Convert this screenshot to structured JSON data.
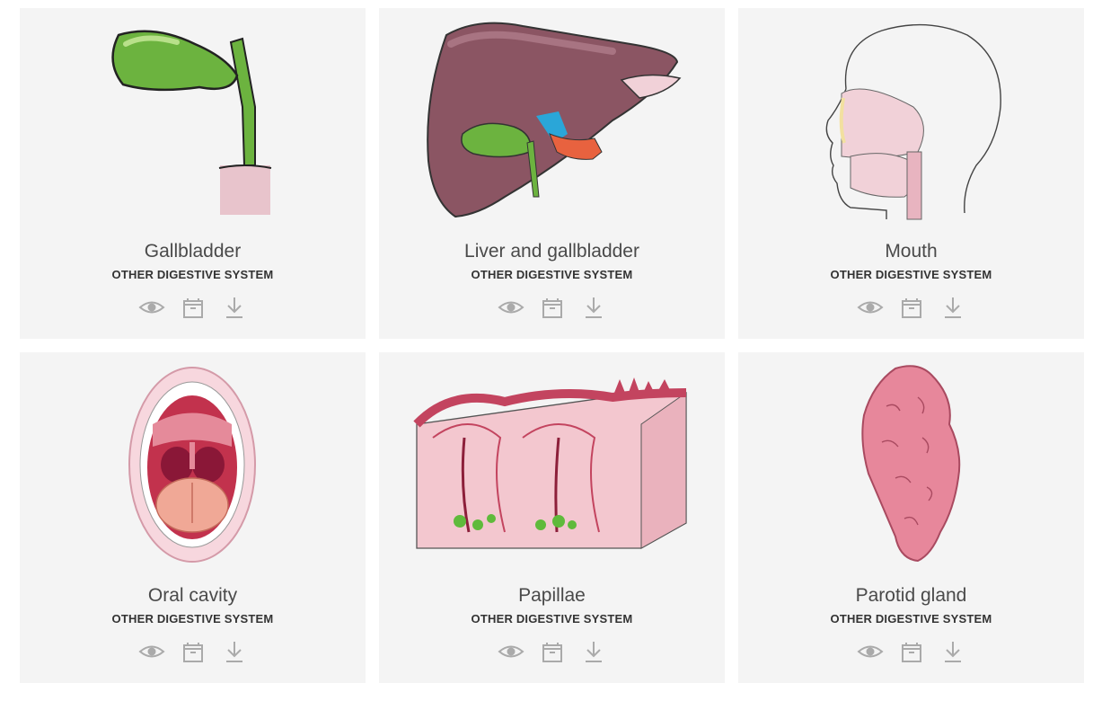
{
  "cards": [
    {
      "title": "Gallbladder",
      "category": "OTHER DIGESTIVE SYSTEM",
      "illustration": "gallbladder-illustration"
    },
    {
      "title": "Liver and gallbladder",
      "category": "OTHER DIGESTIVE SYSTEM",
      "illustration": "liver-illustration"
    },
    {
      "title": "Mouth",
      "category": "OTHER DIGESTIVE SYSTEM",
      "illustration": "head-profile-illustration"
    },
    {
      "title": "Oral cavity",
      "category": "OTHER DIGESTIVE SYSTEM",
      "illustration": "open-mouth-illustration"
    },
    {
      "title": "Papillae",
      "category": "OTHER DIGESTIVE SYSTEM",
      "illustration": "papillae-illustration"
    },
    {
      "title": "Parotid gland",
      "category": "OTHER DIGESTIVE SYSTEM",
      "illustration": "parotid-gland-illustration"
    }
  ],
  "actions": {
    "view_icon": "eye-icon",
    "collection_icon": "box-icon",
    "download_icon": "download-icon"
  },
  "colors": {
    "card_background": "#f4f4f4",
    "icon_gray": "#aaaaaa",
    "title_text": "#4a4a4a",
    "category_text": "#333333"
  }
}
